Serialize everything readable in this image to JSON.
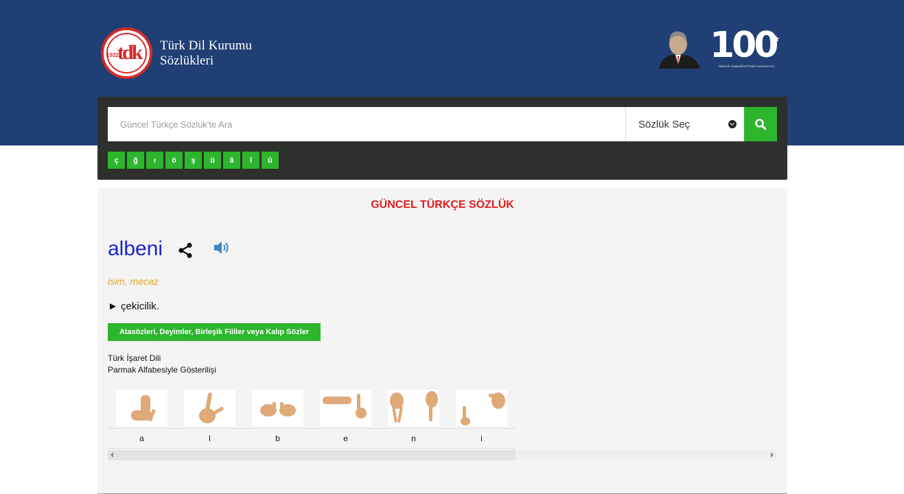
{
  "header": {
    "logo_line1": "Türk Dil Kurumu",
    "logo_line2": "Sözlükleri",
    "logo_year": "1932",
    "logo_mark": "tdk",
    "anniversary_number": "100",
    "anniversary_caption": "TÜRKİYE CUMHURİYETİ'NİN YÜZÜNCÜ YILI"
  },
  "search": {
    "placeholder": "Güncel Türkçe Sözlük'te Ara",
    "dictionary_select_label": "Sözlük Seç",
    "search_icon": "search-icon",
    "special_chars": [
      "ç",
      "ğ",
      "ı",
      "ö",
      "ş",
      "ü",
      "â",
      "î",
      "û"
    ]
  },
  "entry": {
    "dictionary_title": "GÜNCEL TÜRKÇE SÖZLÜK",
    "word": "albeni",
    "share_icon": "share-icon",
    "audio_icon": "speaker-icon",
    "part_of_speech": "isim, mecaz",
    "meaning": "► çekicilik.",
    "phrases_button": "Atasözleri, Deyimler, Birleşik Fiiller veya Kalıp Sözler",
    "sign_language_title": "Türk İşaret Dili",
    "sign_language_subtitle": "Parmak Alfabesiyle Gösterilişi",
    "letters": [
      "a",
      "l",
      "b",
      "e",
      "n",
      "i"
    ]
  },
  "colors": {
    "header_bg": "#1f3f75",
    "panel_bg": "#2e302d",
    "accent_green": "#2db52d",
    "title_red": "#e01b1b",
    "word_blue": "#1b23c9",
    "pos_orange": "#e8a317",
    "skin": "#dfa978"
  }
}
